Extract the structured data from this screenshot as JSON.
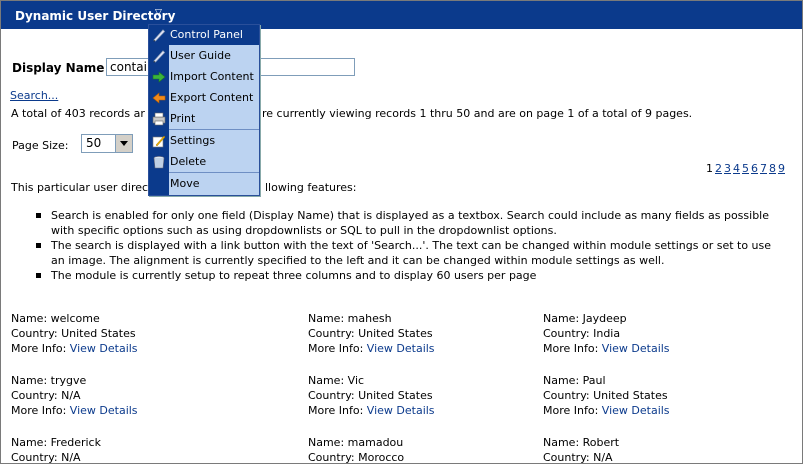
{
  "header": {
    "title": "Dynamic User Directory"
  },
  "search": {
    "label": "Display Name",
    "value": "contain",
    "link": "Search..."
  },
  "summary": "A total of 403 records are found. You are currently viewing records 1 thru 50 and are on page 1 of a total of 9 pages.",
  "summary_visible": {
    "left": "A total of 403 records ar",
    "right": "re currently viewing records 1 thru 50 and are on page 1 of a total of 9 pages."
  },
  "page_size": {
    "label": "Page Size:",
    "value": "50"
  },
  "pager": {
    "current": "1",
    "pages": [
      "2",
      "3",
      "4",
      "5",
      "6",
      "7",
      "8",
      "9"
    ]
  },
  "intro": {
    "left": "This particular user direc",
    "right": "llowing features:"
  },
  "features": [
    "Search is enabled for only one field (Display Name) that is displayed as a textbox. Search could include as many fields as possible with specific options such as using dropdownlists or SQL to pull in the dropdownlist options.",
    "The search is displayed with a link button with the text of 'Search...'. The text can be changed within module settings or set to use an image. The alignment is currently specified to the left and it can be changed within module settings as well.",
    "The module is currently setup to repeat three columns and to display 60 users per page"
  ],
  "users": [
    {
      "name": "Name: welcome",
      "country": "Country: United States",
      "more": "More Info:",
      "link": "View Details"
    },
    {
      "name": "Name: mahesh",
      "country": "Country: United States",
      "more": "More Info:",
      "link": "View Details"
    },
    {
      "name": "Name: Jaydeep",
      "country": "Country: India",
      "more": "More Info:",
      "link": "View Details"
    },
    {
      "name": "Name: trygve",
      "country": "Country: N/A",
      "more": "More Info:",
      "link": "View Details"
    },
    {
      "name": "Name: Vic",
      "country": "Country: United States",
      "more": "More Info:",
      "link": "View Details"
    },
    {
      "name": "Name: Paul",
      "country": "Country: United States",
      "more": "More Info:",
      "link": "View Details"
    },
    {
      "name": "Name: Frederick",
      "country": "Country: N/A",
      "more": "",
      "link": ""
    },
    {
      "name": "Name: mamadou",
      "country": "Country: Morocco",
      "more": "",
      "link": ""
    },
    {
      "name": "Name: Robert",
      "country": "Country: N/A",
      "more": "",
      "link": ""
    }
  ],
  "menu": {
    "items": [
      {
        "label": "Control Panel",
        "icon": "pencil-icon"
      },
      {
        "label": "User Guide",
        "icon": "pencil-icon"
      },
      {
        "label": "Import Content",
        "icon": "arrow-right-icon"
      },
      {
        "label": "Export Content",
        "icon": "arrow-left-icon"
      },
      {
        "label": "Print",
        "icon": "printer-icon"
      },
      {
        "label": "Settings",
        "icon": "settings-icon"
      },
      {
        "label": "Delete",
        "icon": "trash-icon"
      },
      {
        "label": "Move",
        "icon": ""
      }
    ]
  },
  "colors": {
    "header_bg": "#0b3a8c",
    "menu_bg": "#bcd3f1",
    "link": "#0b3a8c"
  }
}
